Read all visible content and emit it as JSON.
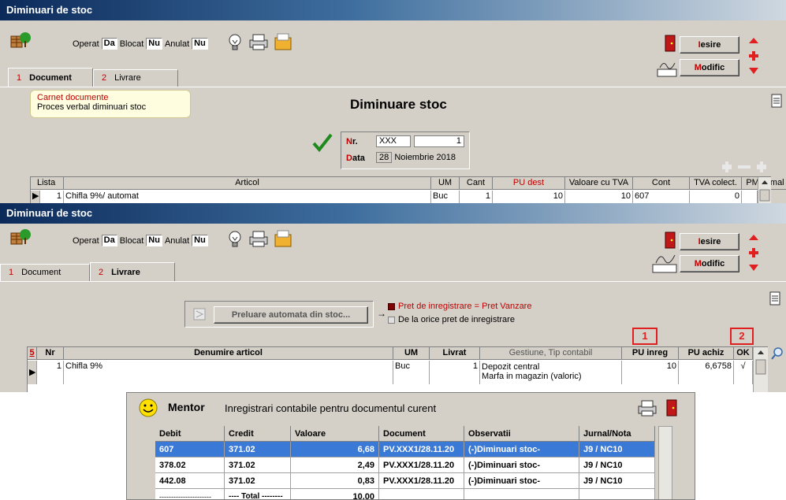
{
  "window1": {
    "title": "Diminuari de stoc",
    "flags": {
      "operat_label": "Operat",
      "operat_val": "Da",
      "blocat_label": "Blocat",
      "blocat_val": "Nu",
      "anulat_label": "Anulat",
      "anulat_val": "Nu"
    },
    "buttons": {
      "iesire": "esire",
      "iesire_hk": "I",
      "modific": "odific",
      "modific_hk": "M"
    },
    "tabs": [
      {
        "num": "1",
        "label": "Document"
      },
      {
        "num": "2",
        "label": "Livrare"
      }
    ],
    "note": {
      "line1": "Carnet documente",
      "line2": "Proces verbal diminuari stoc"
    },
    "heading": "Diminuare stoc",
    "nr_label_hk": "N",
    "nr_label": "r.",
    "nr_series": "XXX",
    "nr_value": "1",
    "data_label_hk": "D",
    "data_label": "ata",
    "date_day": "28",
    "date_rest": "Noiembrie 2018",
    "grid": {
      "headers": [
        "Lista",
        "Articol",
        "UM",
        "Cant",
        "PU dest",
        "Valoare cu TVA",
        "Cont",
        "TVA colect.",
        "PMaximal"
      ],
      "row": {
        "lista": "1",
        "articol": "Chifla 9%/ automat",
        "um": "Buc",
        "cant": "1",
        "pu_dest": "10",
        "valoare": "10",
        "cont": "607",
        "tva": "0",
        "pmax": ""
      }
    }
  },
  "window2": {
    "title": "Diminuari de stoc",
    "flags": {
      "operat_label": "Operat",
      "operat_val": "Da",
      "blocat_label": "Blocat",
      "blocat_val": "Nu",
      "anulat_label": "Anulat",
      "anulat_val": "Nu"
    },
    "buttons": {
      "iesire": "esire",
      "iesire_hk": "I",
      "modific": "odific",
      "modific_hk": "M"
    },
    "tabs": [
      {
        "num": "1",
        "label": "Document"
      },
      {
        "num": "2",
        "label": "Livrare"
      }
    ],
    "preluare_button": "Preluare automata din stoc...",
    "radio1": "Pret de inregistrare = Pret Vanzare",
    "radio2": "De la orice pret de inregistrare",
    "callout1": "1",
    "callout2": "2",
    "grid": {
      "row_count": "5",
      "headers": [
        "Nr",
        "Denumire articol",
        "UM",
        "Livrat",
        "Gestiune, Tip contabil",
        "PU inreg",
        "PU achiz",
        "OK"
      ],
      "row": {
        "nr": "1",
        "denumire": "Chifla 9%",
        "um": "Buc",
        "livrat": "1",
        "gestiune1": "Depozit central",
        "gestiune2": "Marfa in magazin (valoric)",
        "pu_inreg": "10",
        "pu_achiz": "6,6758",
        "ok": "√"
      }
    }
  },
  "mentor": {
    "brand": "Mentor",
    "title": "Inregistrari contabile pentru documentul curent",
    "headers": [
      "Debit",
      "Credit",
      "Valoare",
      "Document",
      "Observatii",
      "Jurnal/Nota"
    ],
    "rows": [
      {
        "debit": "607",
        "credit": "371.02",
        "valoare": "6,68",
        "document": "PV.XXX1/28.11.20",
        "obs": "(-)Diminuari stoc-",
        "jurnal": "J9 / NC10"
      },
      {
        "debit": "378.02",
        "credit": "371.02",
        "valoare": "2,49",
        "document": "PV.XXX1/28.11.20",
        "obs": "(-)Diminuari stoc-",
        "jurnal": "J9 / NC10"
      },
      {
        "debit": "442.08",
        "credit": "371.02",
        "valoare": "0,83",
        "document": "PV.XXX1/28.11.20",
        "obs": "(-)Diminuari stoc-",
        "jurnal": "J9 / NC10"
      }
    ],
    "total_left": "----------------------",
    "total_label": "---- Total --------",
    "total_value": "10,00"
  },
  "colors": {
    "accent_red": "#c00000",
    "selection_blue": "#3a7ad6",
    "title_dark": "#0b2a5a",
    "callout_red": "#e02020"
  }
}
